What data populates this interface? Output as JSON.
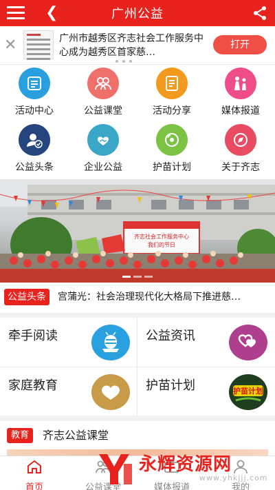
{
  "header": {
    "title": "广州公益"
  },
  "promo": {
    "text": "广州市越秀区齐志社会工作服务中心成为越秀区首家慈…",
    "button": "打开"
  },
  "grid": [
    {
      "label": "活动中心",
      "icon": "list-icon",
      "color": "#2a9fe0"
    },
    {
      "label": "公益课堂",
      "icon": "people-icon",
      "color": "#ef6f6a"
    },
    {
      "label": "活动分享",
      "icon": "document-icon",
      "color": "#f39a1e"
    },
    {
      "label": "媒体报道",
      "icon": "family-icon",
      "color": "#ef4d8a"
    },
    {
      "label": "公益头条",
      "icon": "user-check-icon",
      "color": "#24457e"
    },
    {
      "label": "企业公益",
      "icon": "handshake-heart-icon",
      "color": "#3aa6c8"
    },
    {
      "label": "护苗计划",
      "icon": "disc-icon",
      "color": "#7cc243"
    },
    {
      "label": "关于齐志",
      "icon": "compass-icon",
      "color": "#e84b62"
    }
  ],
  "banner": {
    "sign_line1": "齐志社会工作服务中心",
    "sign_line2": "我们的节日"
  },
  "ticker": {
    "tag": "公益头条",
    "text": "宫蒲光：社会治理现代化大格局下推进慈…"
  },
  "cards": [
    {
      "title": "牵手阅读",
      "icon": "reading-bee-icon",
      "color": "#29a0df"
    },
    {
      "title": "公益资讯",
      "icon": "hearts-icon",
      "color": "#b03e8f"
    },
    {
      "title": "家庭教育",
      "icon": "heart-icon",
      "color": "#c79b47"
    },
    {
      "title": "护苗计划",
      "icon": "seedling-badge-icon",
      "color": "#2e9b45"
    }
  ],
  "card4_badge": "护苗计划",
  "edu": {
    "tag": "教育",
    "title": "齐志公益课堂"
  },
  "tabs": [
    {
      "label": "首页",
      "icon": "home-icon",
      "active": true
    },
    {
      "label": "公益课堂",
      "icon": "people-icon",
      "active": false
    },
    {
      "label": "媒体报道",
      "icon": "tv-icon",
      "active": false
    },
    {
      "label": "我的",
      "icon": "user-icon",
      "active": false
    }
  ],
  "watermark": {
    "brand": "永辉资源网",
    "url": "www.yhkjjj.com"
  }
}
